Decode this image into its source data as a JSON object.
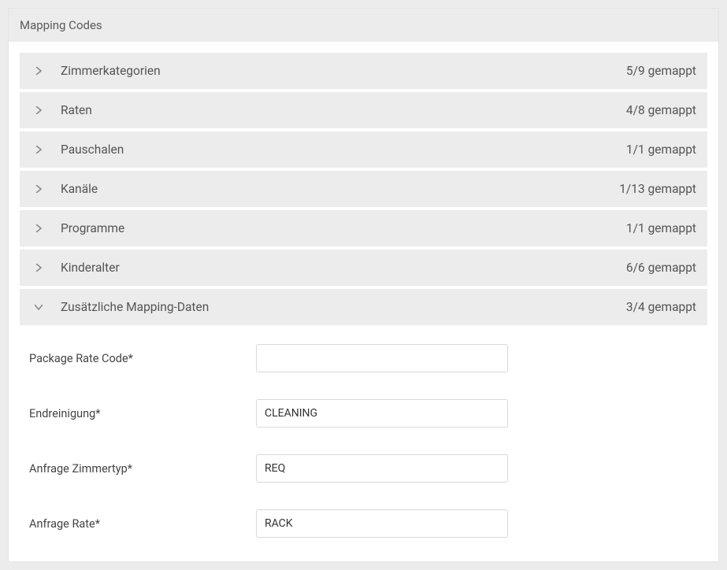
{
  "panel": {
    "title": "Mapping Codes"
  },
  "accordion": {
    "items": [
      {
        "title": "Zimmerkategorien",
        "status": "5/9 gemappt",
        "expanded": false
      },
      {
        "title": "Raten",
        "status": "4/8 gemappt",
        "expanded": false
      },
      {
        "title": "Pauschalen",
        "status": "1/1 gemappt",
        "expanded": false
      },
      {
        "title": "Kanäle",
        "status": "1/13 gemappt",
        "expanded": false
      },
      {
        "title": "Programme",
        "status": "1/1 gemappt",
        "expanded": false
      },
      {
        "title": "Kinderalter",
        "status": "6/6 gemappt",
        "expanded": false
      },
      {
        "title": "Zusätzliche Mapping-Daten",
        "status": "3/4 gemappt",
        "expanded": true
      }
    ]
  },
  "form": {
    "fields": [
      {
        "label": "Package Rate Code*",
        "value": ""
      },
      {
        "label": "Endreinigung*",
        "value": "CLEANING"
      },
      {
        "label": "Anfrage Zimmertyp*",
        "value": "REQ"
      },
      {
        "label": "Anfrage Rate*",
        "value": "RACK"
      }
    ]
  }
}
